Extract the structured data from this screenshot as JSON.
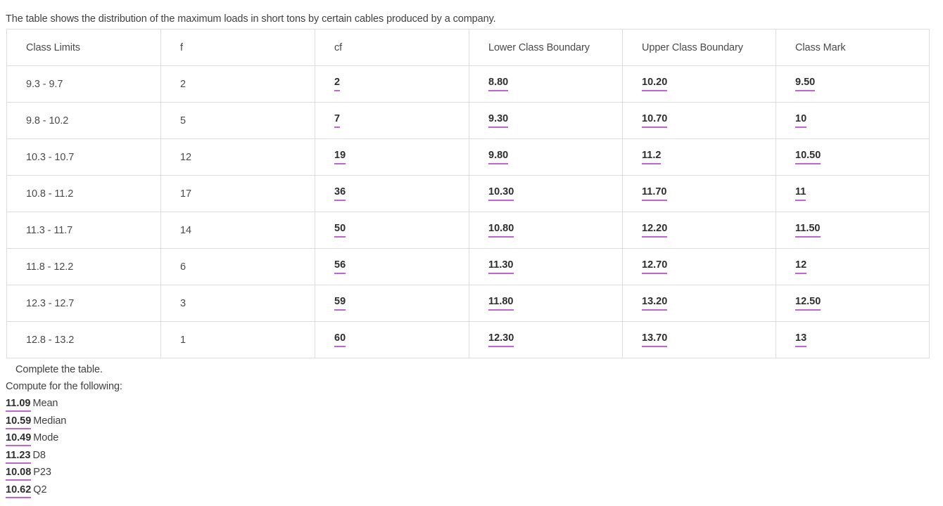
{
  "intro": "The table shows the distribution of the maximum loads in short tons by certain cables produced by a company.",
  "accent_color": "#c164d4",
  "table": {
    "headers": [
      "Class Limits",
      "f",
      "cf",
      "Lower Class Boundary",
      "Upper Class Boundary",
      "Class Mark"
    ],
    "rows": [
      {
        "class_limits": "9.3 - 9.7",
        "f": "2",
        "cf": "2",
        "lcb": "8.80",
        "ucb": "10.20",
        "cm": "9.50"
      },
      {
        "class_limits": "9.8 - 10.2",
        "f": "5",
        "cf": "7",
        "lcb": "9.30",
        "ucb": "10.70",
        "cm": "10"
      },
      {
        "class_limits": "10.3 - 10.7",
        "f": "12",
        "cf": "19",
        "lcb": "9.80",
        "ucb": "11.2",
        "cm": "10.50"
      },
      {
        "class_limits": "10.8 - 11.2",
        "f": "17",
        "cf": "36",
        "lcb": "10.30",
        "ucb": "11.70",
        "cm": "11"
      },
      {
        "class_limits": "11.3 - 11.7",
        "f": "14",
        "cf": "50",
        "lcb": "10.80",
        "ucb": "12.20",
        "cm": "11.50"
      },
      {
        "class_limits": "11.8 - 12.2",
        "f": "6",
        "cf": "56",
        "lcb": "11.30",
        "ucb": "12.70",
        "cm": "12"
      },
      {
        "class_limits": "12.3 - 12.7",
        "f": "3",
        "cf": "59",
        "lcb": "11.80",
        "ucb": "13.20",
        "cm": "12.50"
      },
      {
        "class_limits": "12.8 - 13.2",
        "f": "1",
        "cf": "60",
        "lcb": "12.30",
        "ucb": "13.70",
        "cm": "13"
      }
    ]
  },
  "instructions": {
    "complete": "Complete the table.",
    "compute": "Compute for the following:"
  },
  "stats": [
    {
      "value": "11.09",
      "label": "Mean"
    },
    {
      "value": "10.59",
      "label": "Median"
    },
    {
      "value": "10.49",
      "label": "Mode"
    },
    {
      "value": "11.23",
      "label": "D8"
    },
    {
      "value": "10.08",
      "label": "P23"
    },
    {
      "value": "10.62",
      "label": "Q2"
    }
  ]
}
